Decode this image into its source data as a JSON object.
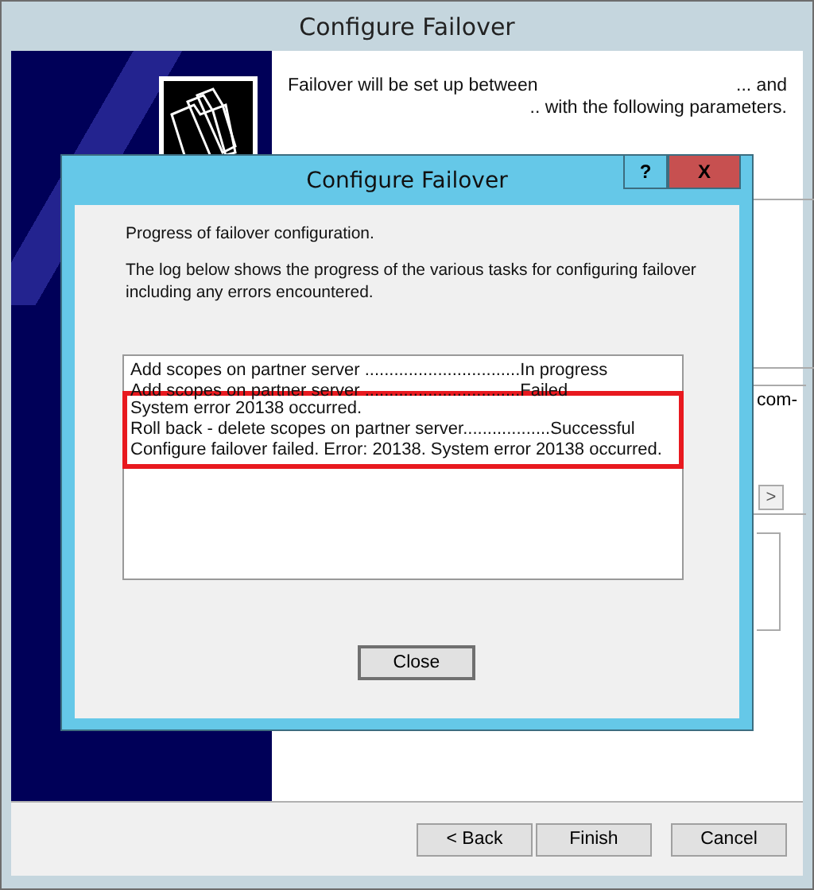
{
  "wizard": {
    "title": "Configure Failover",
    "intro_start": "Failover will be set up between",
    "intro_end": "... and",
    "intro_line_2": ".. with the following parameters.",
    "partial_text": "com-",
    "scroll_arrow": ">",
    "buttons": [
      {
        "label": "< Back"
      },
      {
        "label": "Finish"
      },
      {
        "label": "Cancel"
      }
    ]
  },
  "dialog": {
    "title": "Configure Failover",
    "help": "?",
    "close": "X",
    "heading": "Progress of failover configuration.",
    "description": "The log below shows the progress of the various tasks for configuring failover including any errors encountered.",
    "log": [
      {
        "text": "Add scopes on partner server ................................In progress",
        "highlighted": false
      },
      {
        "text": "Add scopes on partner server ................................Failed",
        "highlighted": false
      },
      {
        "text": "System error 20138 occurred.",
        "highlighted": true
      },
      {
        "text": "Roll back - delete scopes on partner server..................Successful",
        "highlighted": true
      },
      {
        "text": "Configure failover failed. Error: 20138. System error 20138 occurred.",
        "highlighted": true
      }
    ],
    "button": "Close"
  }
}
